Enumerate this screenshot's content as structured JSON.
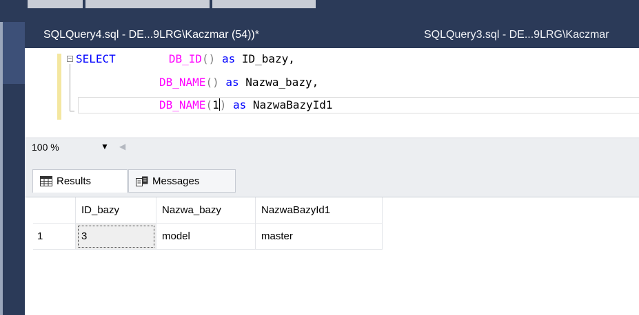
{
  "tabs": [
    {
      "label": "SQLQuery4.sql - DE...9LRG\\Kaczmar (54))*",
      "active": true
    },
    {
      "label": "SQLQuery3.sql - DE...9LRG\\Kaczmar",
      "active": false
    }
  ],
  "editor": {
    "line1": {
      "kw1": "SELECT",
      "fn": "DB_ID",
      "paren": "()",
      "kw2": "as",
      "alias": "ID_bazy,"
    },
    "line2": {
      "fn": "DB_NAME",
      "paren": "()",
      "kw": "as",
      "alias": "Nazwa_bazy,"
    },
    "line3": {
      "fn": "DB_NAME",
      "paren_open": "(",
      "arg": "1",
      "paren_close": ")",
      "kw": "as",
      "alias": "NazwaBazyId1"
    }
  },
  "zoom": {
    "value": "100 %"
  },
  "results_tabs": [
    {
      "label": "Results",
      "icon": "grid-icon",
      "active": true
    },
    {
      "label": "Messages",
      "icon": "messages-icon",
      "active": false
    }
  ],
  "grid": {
    "columns": [
      "ID_bazy",
      "Nazwa_bazy",
      "NazwaBazyId1"
    ],
    "rows": [
      {
        "row_number": "1",
        "cells": [
          "3",
          "model",
          "master"
        ]
      }
    ]
  },
  "colors": {
    "chrome": "#2b3a58",
    "keyword": "#0000ff",
    "function": "#ff00ff",
    "punctuation": "#808080"
  }
}
